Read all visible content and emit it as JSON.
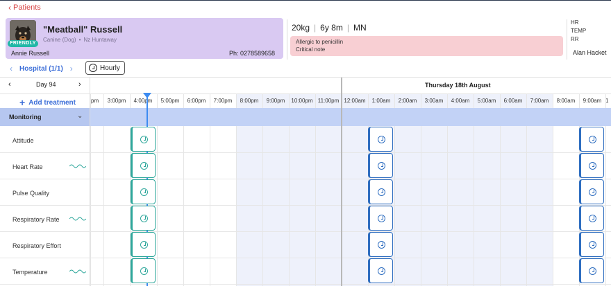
{
  "nav": {
    "back_label": "Patients"
  },
  "patient": {
    "badge": "FRIENDLY",
    "name": "\"Meatball\" Russell",
    "species": "Canine (Dog)",
    "breed": "Nz Huntaway",
    "owner": "Annie  Russell",
    "phone": "Ph: 0278589658",
    "weight": "20kg",
    "age": "6y 8m",
    "sex": "MN",
    "alert_line1": "Allergic to penicillin",
    "alert_line2": "Critical note",
    "vitals": [
      "HR",
      "TEMP",
      "RR"
    ],
    "staff": "Alan Hacket"
  },
  "hospital": {
    "label": "Hospital (1/1)",
    "view_button": "Hourly"
  },
  "sheet": {
    "day_label": "Day 94",
    "date_label": "Thursday 18th August",
    "add_treatment": "Add treatment",
    "hours": [
      "pm",
      "3:00pm",
      "4:00pm",
      "5:00pm",
      "6:00pm",
      "7:00pm",
      "8:00pm",
      "9:00pm",
      "10:00pm",
      "11:00pm",
      "12:00am",
      "1:00am",
      "2:00am",
      "3:00am",
      "4:00am",
      "5:00am",
      "6:00am",
      "7:00am",
      "8:00am",
      "9:00am",
      "1"
    ],
    "group": "Monitoring",
    "rows": [
      "Attitude",
      "Heart Rate",
      "Pulse Quality",
      "Respiratory Rate",
      "Respiratory Effort",
      "Temperature"
    ]
  },
  "colors": {
    "accent": "#3c6ed8",
    "done": "#2ea79b",
    "due": "#2f6ec0",
    "alert": "#f8cfd3",
    "card": "#d9c9f2"
  }
}
